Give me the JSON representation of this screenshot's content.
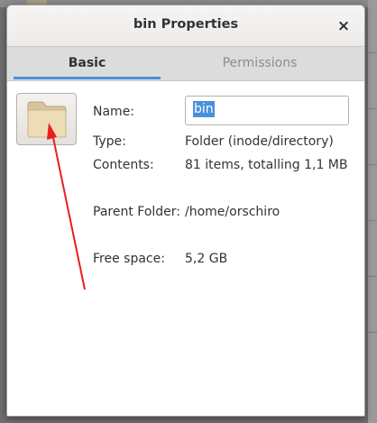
{
  "background": {
    "app": "file manager"
  },
  "dialog": {
    "title": "bin Properties",
    "close_glyph": "×"
  },
  "tabs": [
    {
      "label": "Basic",
      "active": true
    },
    {
      "label": "Permissions",
      "active": false
    }
  ],
  "basic": {
    "icon": "folder-icon",
    "name_label": "Name:",
    "name_value": "bin",
    "type_label": "Type:",
    "type_value": "Folder (inode/directory)",
    "contents_label": "Contents:",
    "contents_value": "81 items, totalling 1,1 MB",
    "parent_label": "Parent Folder:",
    "parent_value": "/home/orschiro",
    "free_label": "Free space:",
    "free_value": "5,2 GB"
  },
  "colors": {
    "accent": "#4a90d9",
    "annotation_arrow": "#e8201e",
    "folder": "#e9d6ac"
  }
}
